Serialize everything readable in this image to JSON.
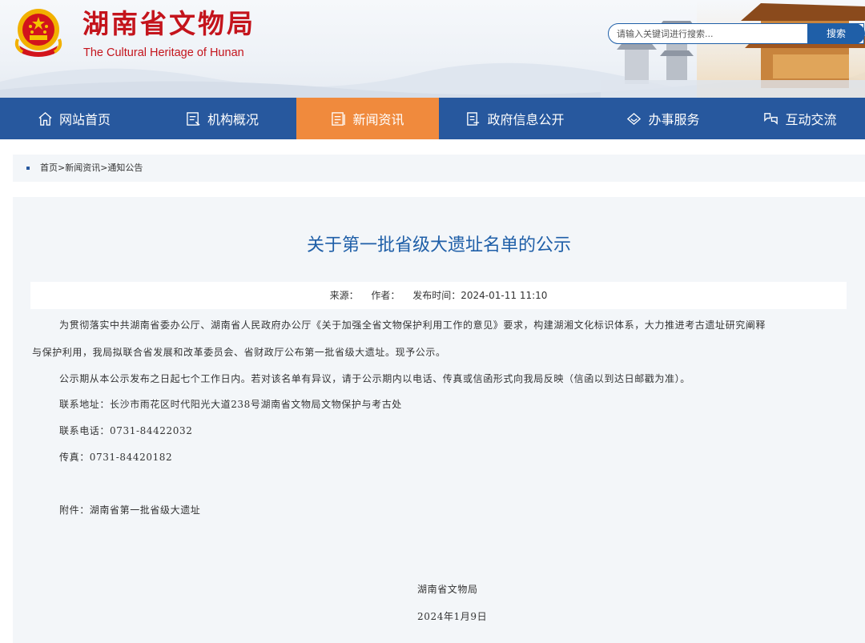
{
  "header": {
    "title": "湖南省文物局",
    "subtitle": "The Cultural Heritage of Hunan",
    "search_placeholder": "请输入关键词进行搜索...",
    "search_button": "搜索"
  },
  "nav": [
    {
      "label": "网站首页",
      "icon": "home-icon"
    },
    {
      "label": "机构概况",
      "icon": "org-icon"
    },
    {
      "label": "新闻资讯",
      "icon": "news-icon",
      "active": true
    },
    {
      "label": "政府信息公开",
      "icon": "document-icon"
    },
    {
      "label": "办事服务",
      "icon": "diamond-icon"
    },
    {
      "label": "互动交流",
      "icon": "interact-icon"
    }
  ],
  "breadcrumb": "首页>新闻资讯>通知公告",
  "article": {
    "title": "关于第一批省级大遗址名单的公示",
    "source_label": "来源：",
    "author_label": "作者：",
    "publish_time": "发布时间：2024-01-11 11:10",
    "para1_line1": "为贯彻落实中共湖南省委办公厅、湖南省人民政府办公厅《关于加强全省文物保护利用工作的意见》要求，构建湖湘文化标识体系，大力推进考古遗址研究阐释",
    "para1_line2": "与保护利用，我局拟联合省发展和改革委员会、省财政厅公布第一批省级大遗址。现予公示。",
    "para2": "公示期从本公示发布之日起七个工作日内。若对该名单有异议，请于公示期内以电话、传真或信函形式向我局反映（信函以到达日邮戳为准）。",
    "address": "联系地址：长沙市雨花区时代阳光大道238号湖南省文物局文物保护与考古处",
    "phone": "联系电话：0731-84422032",
    "fax": "传真：0731-84420182",
    "attachment": "附件：湖南省第一批省级大遗址",
    "signature": "湖南省文物局",
    "date": "2024年1月9日"
  },
  "colors": {
    "brand_red": "#c4141c",
    "nav_blue": "#27589e",
    "nav_active": "#f08a3d",
    "title_blue": "#1f5fa8"
  }
}
